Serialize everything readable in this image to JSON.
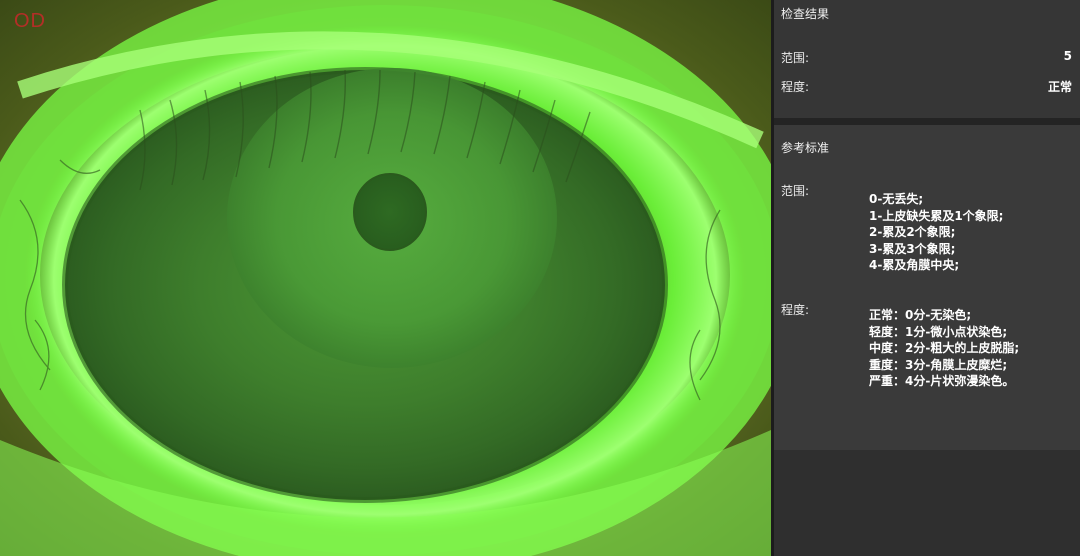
{
  "viewer": {
    "eye_label": "OD"
  },
  "result": {
    "title": "检查结果",
    "range_label": "范围:",
    "range_value": "5",
    "degree_label": "程度:",
    "degree_value": "正常"
  },
  "reference": {
    "title": "参考标准",
    "range_label": "范围:",
    "range_items": [
      "0-无丢失;",
      "1-上皮缺失累及1个象限;",
      "2-累及2个象限;",
      "3-累及3个象限;",
      "4-累及角膜中央;"
    ],
    "degree_label": "程度:",
    "degree_items": [
      "正常：0分-无染色;",
      "轻度：1分-微小点状染色;",
      "中度：2分-粗大的上皮脱脂;",
      "重度：3分-角膜上皮糜烂;",
      "严重：4分-片状弥漫染色。"
    ]
  },
  "colors": {
    "fluorescein_green": "#6dff3a",
    "cornea_green": "#3f7a2a",
    "eye_label_red": "#c8292a"
  }
}
